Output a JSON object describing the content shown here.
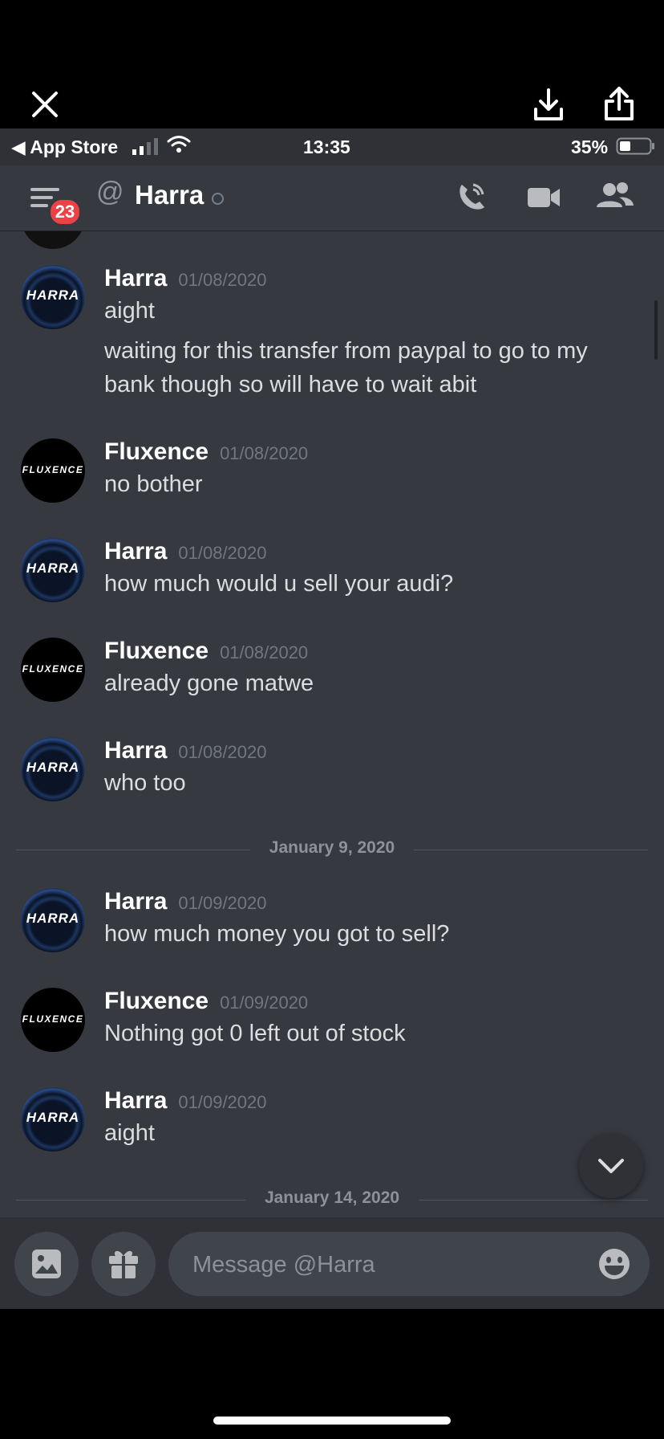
{
  "viewer": {
    "close": "close-icon",
    "download": "download-icon",
    "share": "share-icon"
  },
  "status_bar": {
    "back_app": "◀ App Store",
    "time": "13:35",
    "battery": "35%"
  },
  "header": {
    "unread_badge": "23",
    "channel_name": "Harra",
    "at_symbol": "@"
  },
  "messages": [
    {
      "author": "Harra",
      "time": "01/08/2020",
      "avatar": "HARRA",
      "lines": [
        "aight",
        "waiting for this transfer from paypal to go to my",
        "bank though so will have to wait abit"
      ]
    },
    {
      "author": "Fluxence",
      "time": "01/08/2020",
      "avatar": "FLUXENCE",
      "lines": [
        "no bother"
      ]
    },
    {
      "author": "Harra",
      "time": "01/08/2020",
      "avatar": "HARRA",
      "lines": [
        "how much would u sell your audi?"
      ]
    },
    {
      "author": "Fluxence",
      "time": "01/08/2020",
      "avatar": "FLUXENCE",
      "lines": [
        "already gone matwe"
      ]
    },
    {
      "author": "Harra",
      "time": "01/08/2020",
      "avatar": "HARRA",
      "lines": [
        "who too"
      ]
    },
    {
      "author": "Harra",
      "time": "01/09/2020",
      "avatar": "HARRA",
      "lines": [
        "how much money you got to sell?"
      ]
    },
    {
      "author": "Fluxence",
      "time": "01/09/2020",
      "avatar": "FLUXENCE",
      "lines": [
        "Nothing got 0 left out of stock"
      ]
    },
    {
      "author": "Harra",
      "time": "01/09/2020",
      "avatar": "HARRA",
      "lines": [
        "aight"
      ]
    }
  ],
  "dividers": [
    "January 9, 2020",
    "January 14, 2020"
  ],
  "composer": {
    "placeholder": "Message @Harra"
  },
  "colors": {
    "background": "#36393f",
    "header": "#2f3136",
    "badge": "#ed4245",
    "timestamp": "#72767d"
  }
}
